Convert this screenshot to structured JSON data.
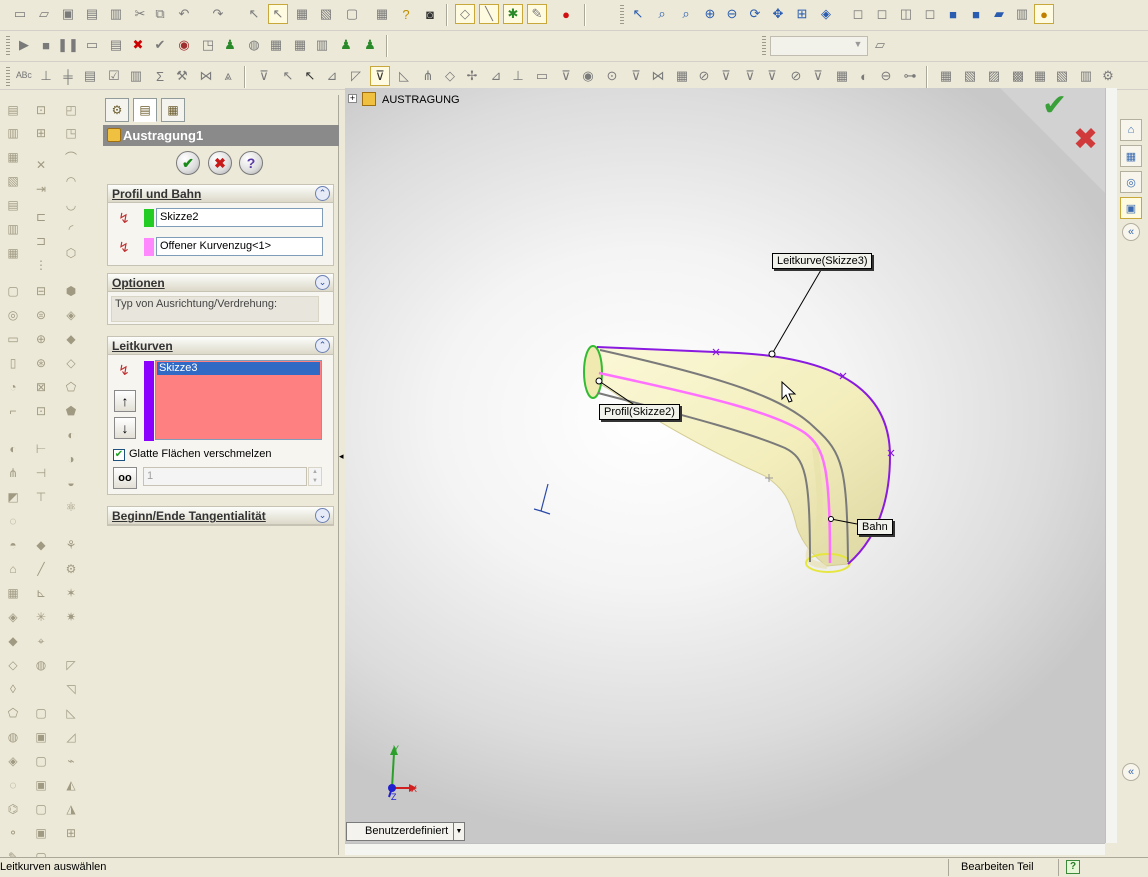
{
  "toolbars": {
    "row1_icons": [
      "new-icon",
      "open-icon",
      "save-icon",
      "print-icon",
      "undo-icon",
      "redo-icon",
      "select-icon",
      "help-icon",
      "camera-icon",
      "zoom-fit-icon",
      "zoom-area-icon",
      "zoom-in-icon",
      "zoom-out-icon",
      "rotate-icon",
      "pan-icon",
      "view-orientation-icon",
      "wireframe-icon",
      "hidden-lines-icon",
      "shaded-icon",
      "shaded-edges-icon",
      "appearance-icon"
    ],
    "combo_empty": ""
  },
  "property_manager": {
    "title": "Austragung1",
    "tabs": [
      "feature-manager-tab",
      "property-manager-tab",
      "configuration-manager-tab"
    ],
    "ok": "✔",
    "cancel": "✖",
    "help": "?",
    "profile_path": {
      "header": "Profil und Bahn",
      "profile_value": "Skizze2",
      "profile_color": "#22cc22",
      "path_value": "Offener Kurvenzug<1>",
      "path_color": "#ff88ff"
    },
    "options": {
      "header": "Optionen",
      "orientation_label": "Typ von Ausrichtung/Verdrehung:",
      "orientation_value": ""
    },
    "guide_curves": {
      "header": "Leitkurven",
      "items": [
        "Skizze3"
      ],
      "list_color": "#ff8080",
      "bar_color": "#8b00ff",
      "up": "↑",
      "down": "↓",
      "merge_label": "Glatte Flächen verschmelzen",
      "merge_checked": true,
      "spinner_value": "1"
    },
    "tangency": {
      "header": "Beginn/Ende Tangentialität"
    }
  },
  "viewport": {
    "tree_root": "AUSTRAGUNG",
    "callouts": {
      "guide": "Leitkurve(Skizze3)",
      "profile": "Profil(Skizze2)",
      "path": "Bahn"
    },
    "confirm_ok": "✔",
    "confirm_cancel": "✖",
    "axis_x": "X",
    "axis_y": "Y",
    "axis_z": "Z",
    "view_tab": "Benutzerdefiniert"
  },
  "status_bar": {
    "message": "Leitkurven auswählen",
    "mode": "Bearbeiten Teil",
    "help": "?"
  }
}
